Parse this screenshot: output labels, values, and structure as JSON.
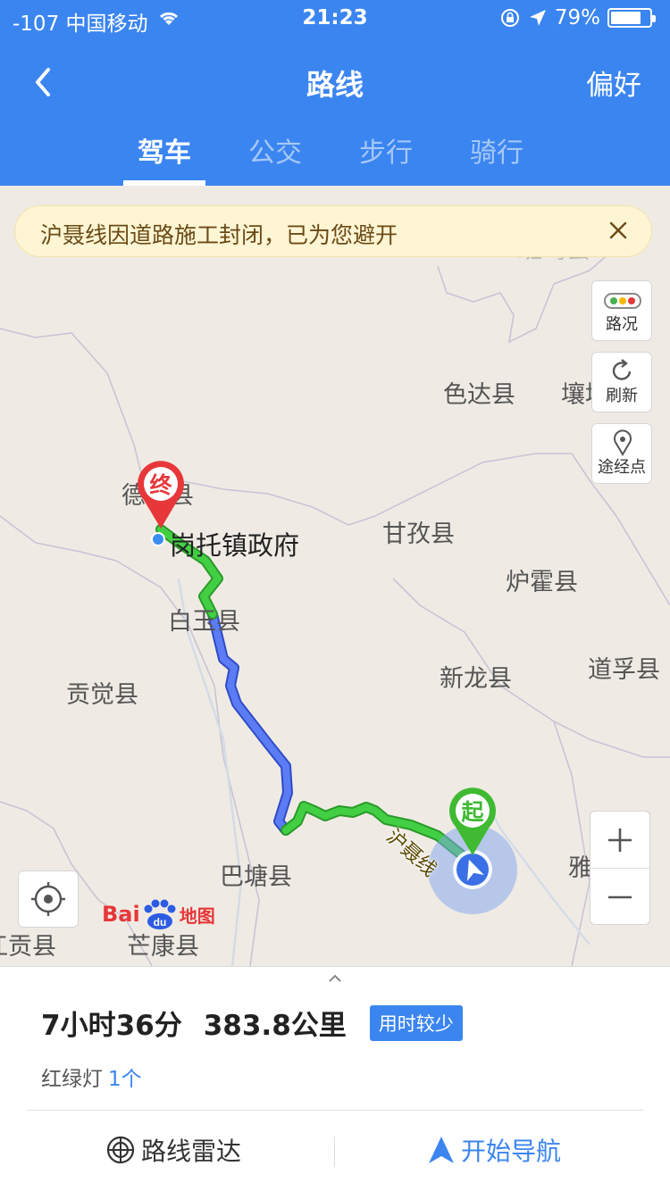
{
  "status_bar": {
    "signal": "-107 中国移动",
    "time": "21:23",
    "battery": "79%",
    "battery_level": 0.79
  },
  "navbar": {
    "back_icon": "chevron-left-icon",
    "title": "路线",
    "preference_label": "偏好"
  },
  "tabs": [
    {
      "label": "驾车",
      "active": true
    },
    {
      "label": "公交",
      "active": false
    },
    {
      "label": "步行",
      "active": false
    },
    {
      "label": "骑行",
      "active": false
    }
  ],
  "map": {
    "notice_text": "沪聂线因道路施工封闭，已为您避开",
    "controls": {
      "traffic_label": "路况",
      "refresh_label": "刷新",
      "waypoint_label": "途经点",
      "zoom_in": "+",
      "zoom_out": "−"
    },
    "places": [
      {
        "name": "班玛县"
      },
      {
        "name": "色达县"
      },
      {
        "name": "壤塘"
      },
      {
        "name": "德格县"
      },
      {
        "name": "岗托镇政府"
      },
      {
        "name": "甘孜县"
      },
      {
        "name": "炉霍县"
      },
      {
        "name": "白玉县"
      },
      {
        "name": "道孚县"
      },
      {
        "name": "新龙县"
      },
      {
        "name": "贡觉县"
      },
      {
        "name": "巴塘县"
      },
      {
        "name": "雅江县"
      },
      {
        "name": "江贡县"
      },
      {
        "name": "芒康县"
      }
    ],
    "route_label": "沪聂线",
    "start_marker": "起",
    "end_marker": "终",
    "logo_text_bai": "Bai",
    "logo_text_du": "du",
    "logo_text_map": "地图",
    "colors": {
      "route_green": "#3cc43c",
      "route_blue": "#4a6cf0",
      "end_red": "#e8373a",
      "start_green": "#3fba32"
    }
  },
  "summary": {
    "duration": "7小时36分",
    "distance": "383.8公里",
    "badge": "用时较少",
    "traffic_lights_label": "红绿灯",
    "traffic_lights_count": "1个"
  },
  "actions": {
    "radar_label": "路线雷达",
    "navigate_label": "开始导航"
  }
}
